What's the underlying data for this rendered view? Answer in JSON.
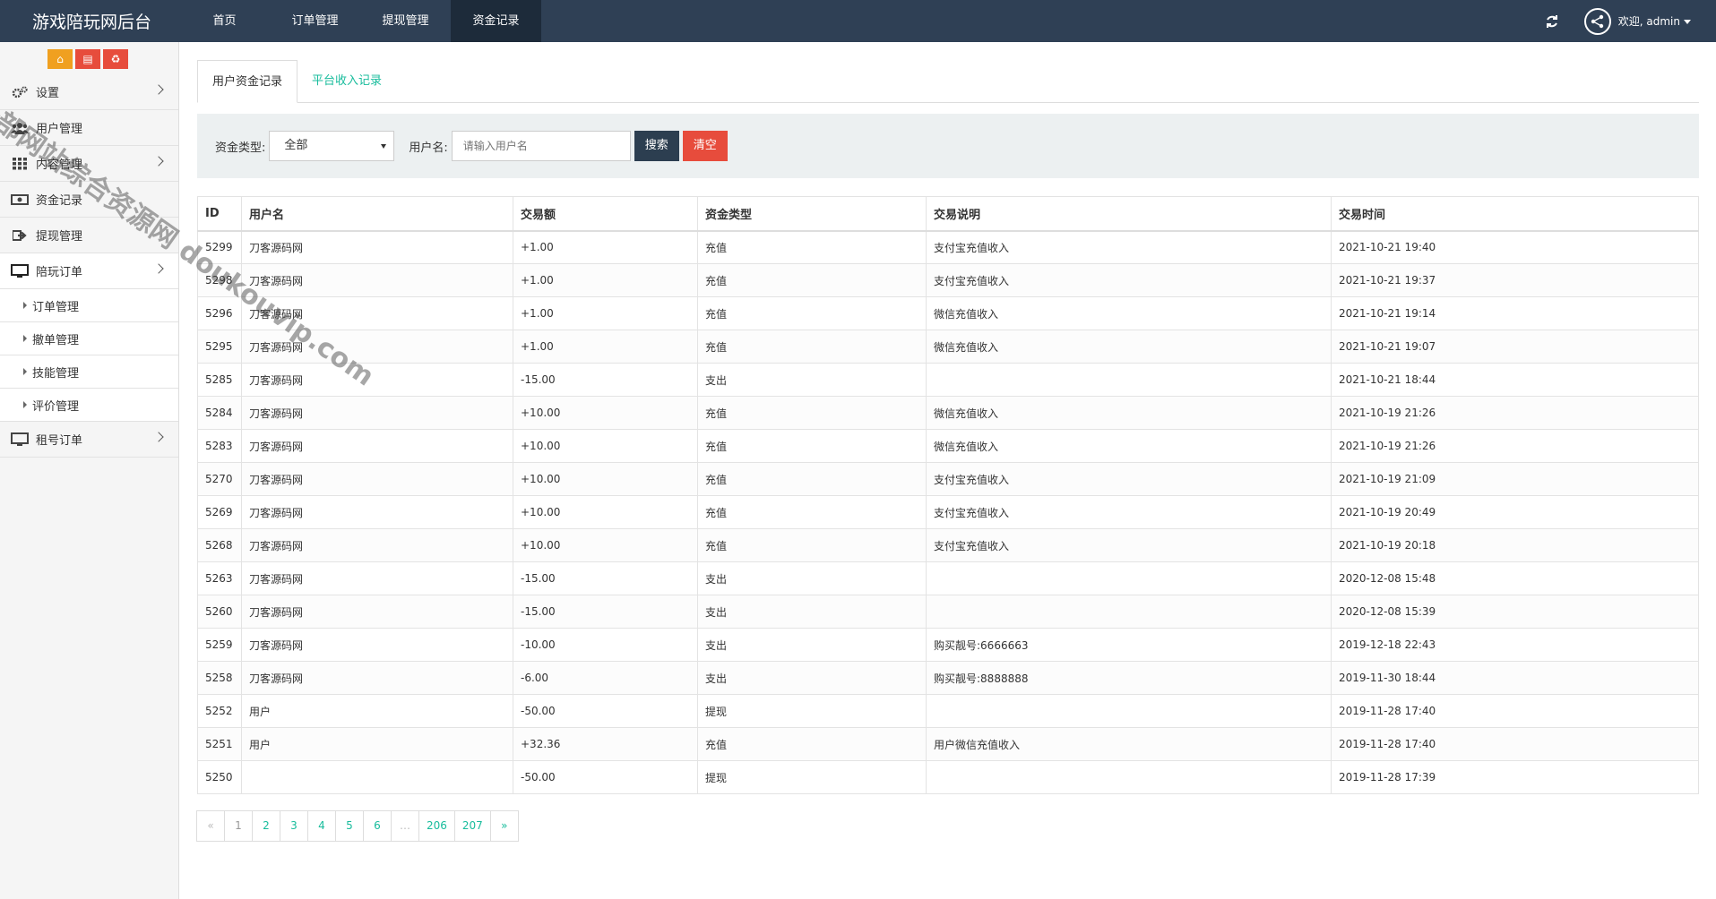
{
  "brand": "游戏陪玩网后台",
  "top_nav": [
    {
      "label": "首页",
      "active": false
    },
    {
      "label": "订单管理",
      "active": false
    },
    {
      "label": "提现管理",
      "active": false
    },
    {
      "label": "资金记录",
      "active": true
    }
  ],
  "user": {
    "welcome": "欢迎, admin"
  },
  "sidebar": {
    "items": [
      {
        "label": "设置",
        "icon": "gears-icon",
        "has_children": true
      },
      {
        "label": "用户管理",
        "icon": "users-icon",
        "has_children": false
      },
      {
        "label": "内容管理",
        "icon": "grid-icon",
        "has_children": true
      },
      {
        "label": "资金记录",
        "icon": "money-icon",
        "has_children": false
      },
      {
        "label": "提现管理",
        "icon": "sign-out-icon",
        "has_children": false
      },
      {
        "label": "陪玩订单",
        "icon": "monitor-icon",
        "has_children": true,
        "open": true
      },
      {
        "label": "租号订单",
        "icon": "monitor-icon",
        "has_children": true
      }
    ],
    "sub_items": [
      "订单管理",
      "撤单管理",
      "技能管理",
      "评价管理"
    ]
  },
  "tabs": [
    {
      "label": "用户资金记录",
      "active": true
    },
    {
      "label": "平台收入记录",
      "active": false
    }
  ],
  "filter": {
    "type_label": "资金类型:",
    "type_value": "全部",
    "username_label": "用户名:",
    "username_placeholder": "请输入用户名",
    "search_label": "搜索",
    "clear_label": "清空"
  },
  "table": {
    "headers": [
      "ID",
      "用户名",
      "交易额",
      "资金类型",
      "交易说明",
      "交易时间"
    ],
    "rows": [
      [
        "5299",
        "刀客源码网",
        "+1.00",
        "充值",
        "支付宝充值收入",
        "2021-10-21 19:40"
      ],
      [
        "5298",
        "刀客源码网",
        "+1.00",
        "充值",
        "支付宝充值收入",
        "2021-10-21 19:37"
      ],
      [
        "5296",
        "刀客源码网",
        "+1.00",
        "充值",
        "微信充值收入",
        "2021-10-21 19:14"
      ],
      [
        "5295",
        "刀客源码网",
        "+1.00",
        "充值",
        "微信充值收入",
        "2021-10-21 19:07"
      ],
      [
        "5285",
        "刀客源码网",
        "-15.00",
        "支出",
        "",
        "2021-10-21 18:44"
      ],
      [
        "5284",
        "刀客源码网",
        "+10.00",
        "充值",
        "微信充值收入",
        "2021-10-19 21:26"
      ],
      [
        "5283",
        "刀客源码网",
        "+10.00",
        "充值",
        "微信充值收入",
        "2021-10-19 21:26"
      ],
      [
        "5270",
        "刀客源码网",
        "+10.00",
        "充值",
        "支付宝充值收入",
        "2021-10-19 21:09"
      ],
      [
        "5269",
        "刀客源码网",
        "+10.00",
        "充值",
        "支付宝充值收入",
        "2021-10-19 20:49"
      ],
      [
        "5268",
        "刀客源码网",
        "+10.00",
        "充值",
        "支付宝充值收入",
        "2021-10-19 20:18"
      ],
      [
        "5263",
        "刀客源码网",
        "-15.00",
        "支出",
        "",
        "2020-12-08 15:48"
      ],
      [
        "5260",
        "刀客源码网",
        "-15.00",
        "支出",
        "",
        "2020-12-08 15:39"
      ],
      [
        "5259",
        "刀客源码网",
        "-10.00",
        "支出",
        "购买靓号:6666663",
        "2019-12-18 22:43"
      ],
      [
        "5258",
        "刀客源码网",
        "-6.00",
        "支出",
        "购买靓号:8888888",
        "2019-11-30 18:44"
      ],
      [
        "5252",
        "用户",
        "-50.00",
        "提现",
        "",
        "2019-11-28 17:40"
      ],
      [
        "5251",
        "用户",
        "+32.36",
        "充值",
        "用户微信充值收入",
        "2019-11-28 17:40"
      ],
      [
        "5250",
        "",
        "-50.00",
        "提现",
        "",
        "2019-11-28 17:39"
      ]
    ]
  },
  "pagination": [
    "«",
    "1",
    "2",
    "3",
    "4",
    "5",
    "6",
    "…",
    "206",
    "207",
    "»"
  ],
  "watermark": "全部网站综合资源网 doukouvip.com",
  "colors": {
    "topbar": "#2f4055",
    "accent": "#18bc9c",
    "danger": "#e74c3c",
    "dark_button": "#2c3e50"
  }
}
